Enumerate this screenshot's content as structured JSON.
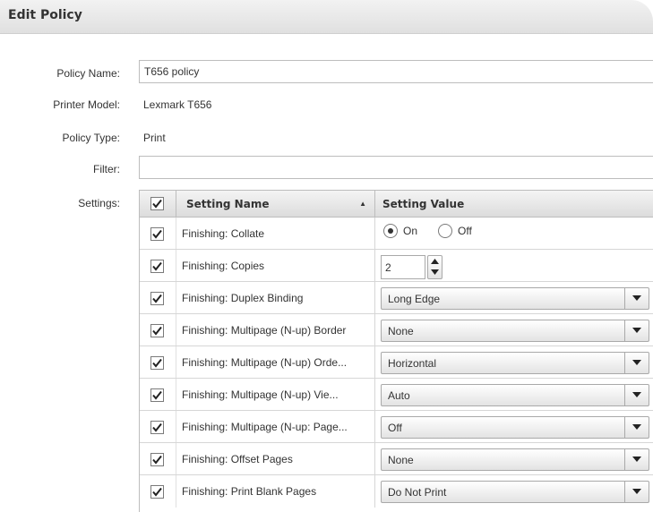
{
  "panel": {
    "title": "Edit Policy"
  },
  "form": {
    "policy_name_label": "Policy Name:",
    "policy_name_value": "T656 policy",
    "printer_model_label": "Printer Model:",
    "printer_model_value": "Lexmark T656",
    "policy_type_label": "Policy Type:",
    "policy_type_value": "Print",
    "filter_label": "Filter:",
    "filter_value": "",
    "settings_label": "Settings:"
  },
  "table": {
    "header": {
      "select_all_checked": true,
      "name_header": "Setting Name",
      "sort_direction": "ascending",
      "value_header": "Setting Value"
    },
    "rows": [
      {
        "checked": true,
        "name": "Finishing: Collate",
        "control": "radio",
        "options": [
          "On",
          "Off"
        ],
        "selected": "On"
      },
      {
        "checked": true,
        "name": "Finishing: Copies",
        "control": "stepper",
        "value": "2"
      },
      {
        "checked": true,
        "name": "Finishing: Duplex Binding",
        "control": "select",
        "value": "Long Edge"
      },
      {
        "checked": true,
        "name": "Finishing: Multipage (N-up) Border",
        "control": "select",
        "value": "None"
      },
      {
        "checked": true,
        "name": "Finishing: Multipage (N-up) Orde...",
        "control": "select",
        "value": "Horizontal"
      },
      {
        "checked": true,
        "name": "Finishing: Multipage (N-up) Vie...",
        "control": "select",
        "value": "Auto"
      },
      {
        "checked": true,
        "name": "Finishing: Multipage (N-up: Page...",
        "control": "select",
        "value": "Off"
      },
      {
        "checked": true,
        "name": "Finishing: Offset Pages",
        "control": "select",
        "value": "None"
      },
      {
        "checked": true,
        "name": "Finishing: Print Blank Pages",
        "control": "select",
        "value": "Do Not Print"
      }
    ]
  },
  "icons": {
    "checkmark": "checkmark-icon",
    "sort": "sort-ascending-icon",
    "dropdown": "triangle-down-icon",
    "stepper_up": "triangle-up-icon",
    "stepper_down": "triangle-down-icon"
  },
  "colors": {
    "header_bg": "#e6e6e6",
    "border": "#bdbdbd",
    "text": "#333333"
  }
}
